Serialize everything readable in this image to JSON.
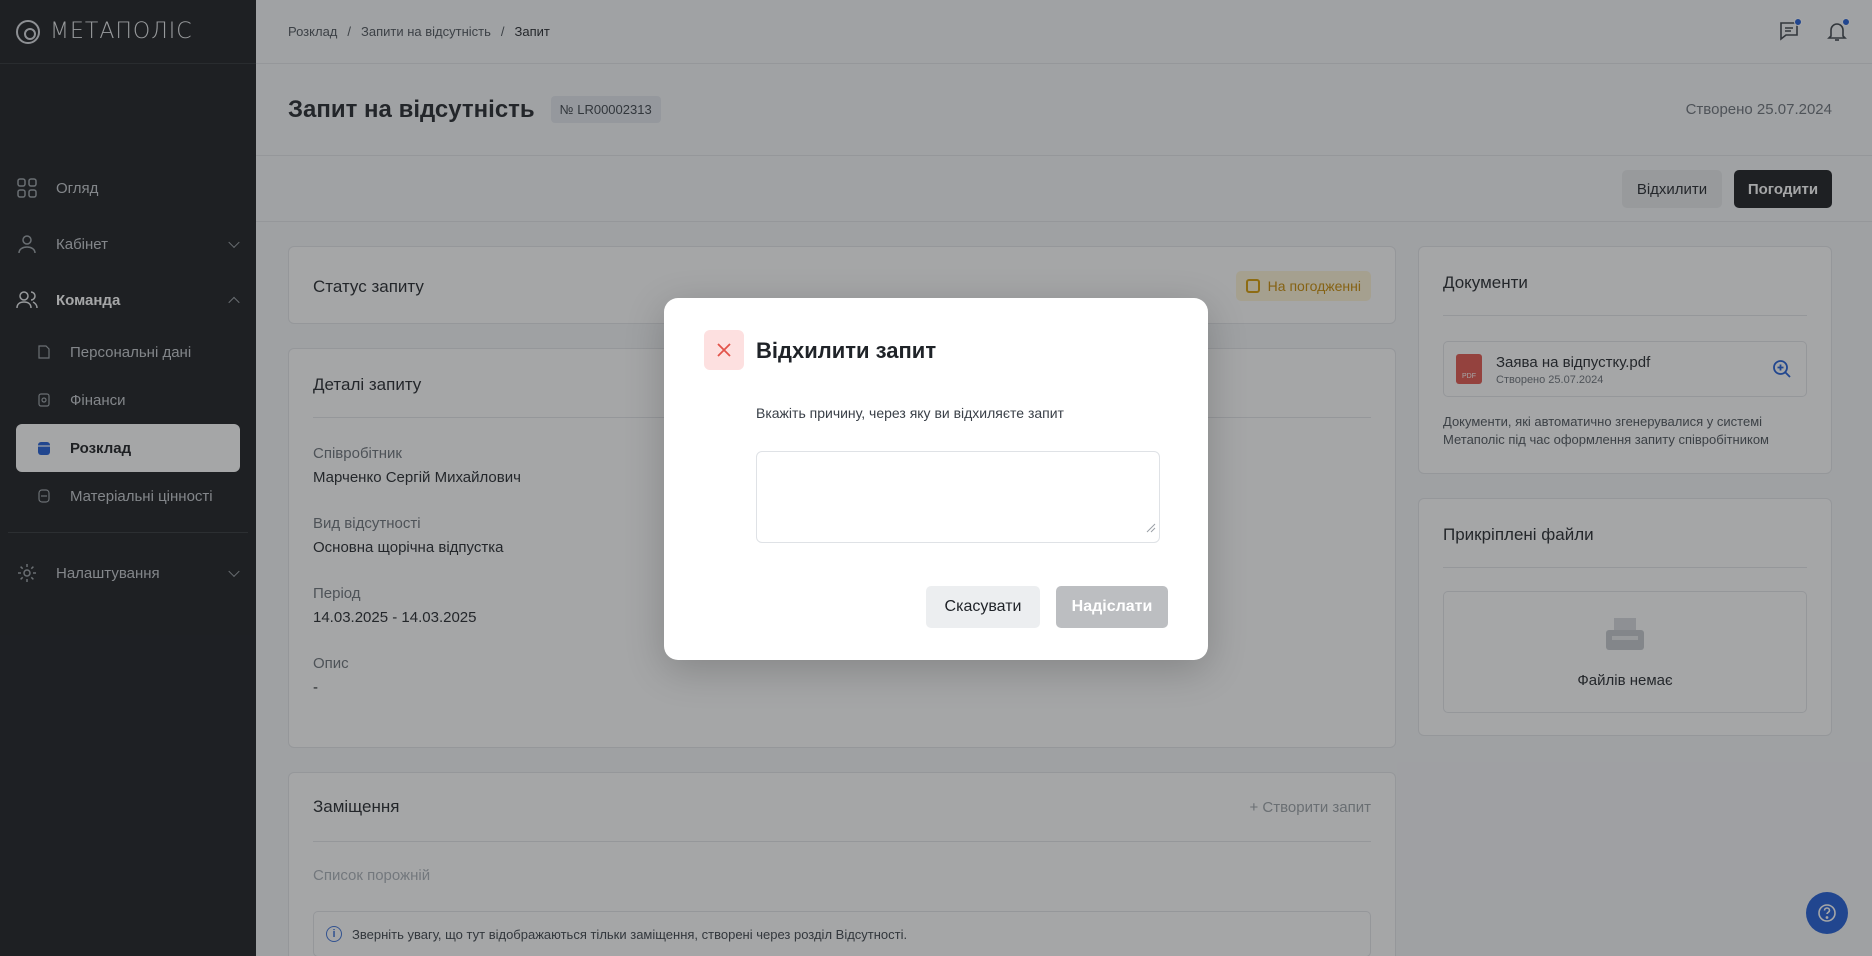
{
  "app": {
    "logo_text": "МЕТАПОЛІС"
  },
  "sidebar": {
    "items": [
      {
        "label": "Огляд"
      },
      {
        "label": "Кабінет"
      },
      {
        "label": "Команда"
      },
      {
        "label": "Налаштування"
      }
    ],
    "team_sub": [
      {
        "label": "Персональні дані"
      },
      {
        "label": "Фінанси"
      },
      {
        "label": "Розклад"
      },
      {
        "label": "Матеріальні цінності"
      }
    ]
  },
  "breadcrumb": [
    "Розклад",
    "Запити на відсутність",
    "Запит"
  ],
  "header": {
    "title": "Запит на відсутність",
    "number": "№ LR00002313",
    "created": "Створено 25.07.2024"
  },
  "actions": {
    "reject": "Відхилити",
    "approve": "Погодити"
  },
  "status": {
    "title": "Статус запиту",
    "value": "На погодженні",
    "color": "#c98a00"
  },
  "details": {
    "title": "Деталі запиту",
    "fields": [
      {
        "label": "Співробітник",
        "value": "Марченко Сергій Михайлович"
      },
      {
        "label": "Вид відсутності",
        "value": "Основна щорічна відпустка"
      },
      {
        "label": "Період",
        "value": "14.03.2025 - 14.03.2025"
      },
      {
        "label": "Опис",
        "value": "-"
      }
    ]
  },
  "replacement": {
    "title": "Заміщення",
    "create": "+ Створити запит",
    "empty": "Список порожній",
    "notice": "Зверніть увагу, що тут відображаються тільки заміщення, створені через розділ Відсутності."
  },
  "documents": {
    "title": "Документи",
    "file_name": "Заява на відпустку.pdf",
    "file_date": "Створено 25.07.2024",
    "file_type": "PDF",
    "note": "Документи, які автоматично згенерувалися у системі Метаполіс під час оформлення запиту співробітником"
  },
  "attachments": {
    "title": "Прикріплені файли",
    "empty": "Файлів немає"
  },
  "modal": {
    "title": "Відхилити запит",
    "prompt": "Вкажіть причину, через яку ви відхиляєте запит",
    "reason_value": "",
    "cancel": "Скасувати",
    "send": "Надіслати"
  },
  "colors": {
    "accent": "#1c5bd6",
    "sidebar_bg": "#17191c",
    "danger_bg": "#fde0e0",
    "danger": "#e2534a"
  }
}
